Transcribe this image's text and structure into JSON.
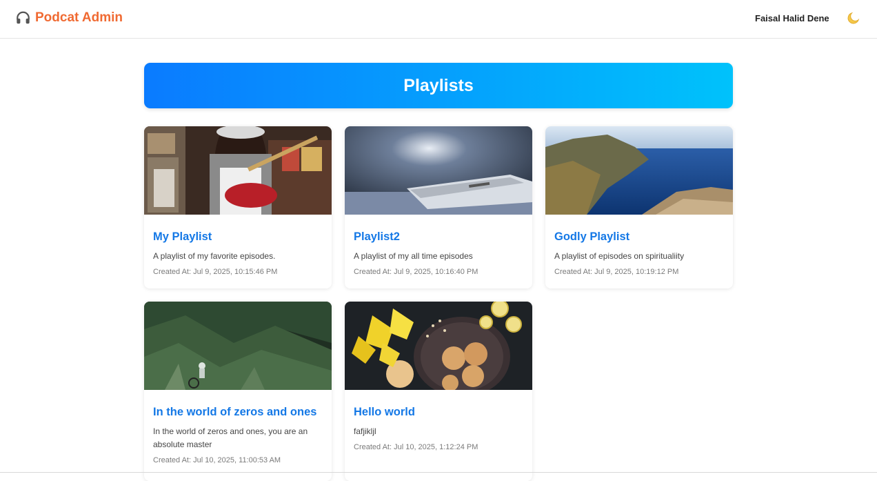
{
  "header": {
    "brand": "Podcat Admin",
    "brand_icon": "headphones-icon",
    "user_name": "Faisal Halid Dene",
    "theme_icon": "moon-icon"
  },
  "banner": {
    "title": "Playlists"
  },
  "colors": {
    "brand": "#f06a32",
    "link": "#1478e6",
    "banner_start": "#0a7bff",
    "banner_end": "#00c2fb"
  },
  "playlists": [
    {
      "title": "My Playlist",
      "description": "A playlist of my favorite episodes.",
      "created": "Created At: Jul 9, 2025, 10:15:46 PM"
    },
    {
      "title": "Playlist2",
      "description": "A playlist of my all time episodes",
      "created": "Created At: Jul 9, 2025, 10:16:40 PM"
    },
    {
      "title": "Godly Playlist",
      "description": "A playlist of episodes on spiritualiity",
      "created": "Created At: Jul 9, 2025, 10:19:12 PM"
    },
    {
      "title": "In the world of zeros and ones",
      "description": "In the world of zeros and ones, you are an absolute master",
      "created": "Created At: Jul 10, 2025, 11:00:53 AM"
    },
    {
      "title": "Hello world",
      "description": "fafjikljl",
      "created": "Created At: Jul 10, 2025, 1:12:24 PM"
    }
  ]
}
